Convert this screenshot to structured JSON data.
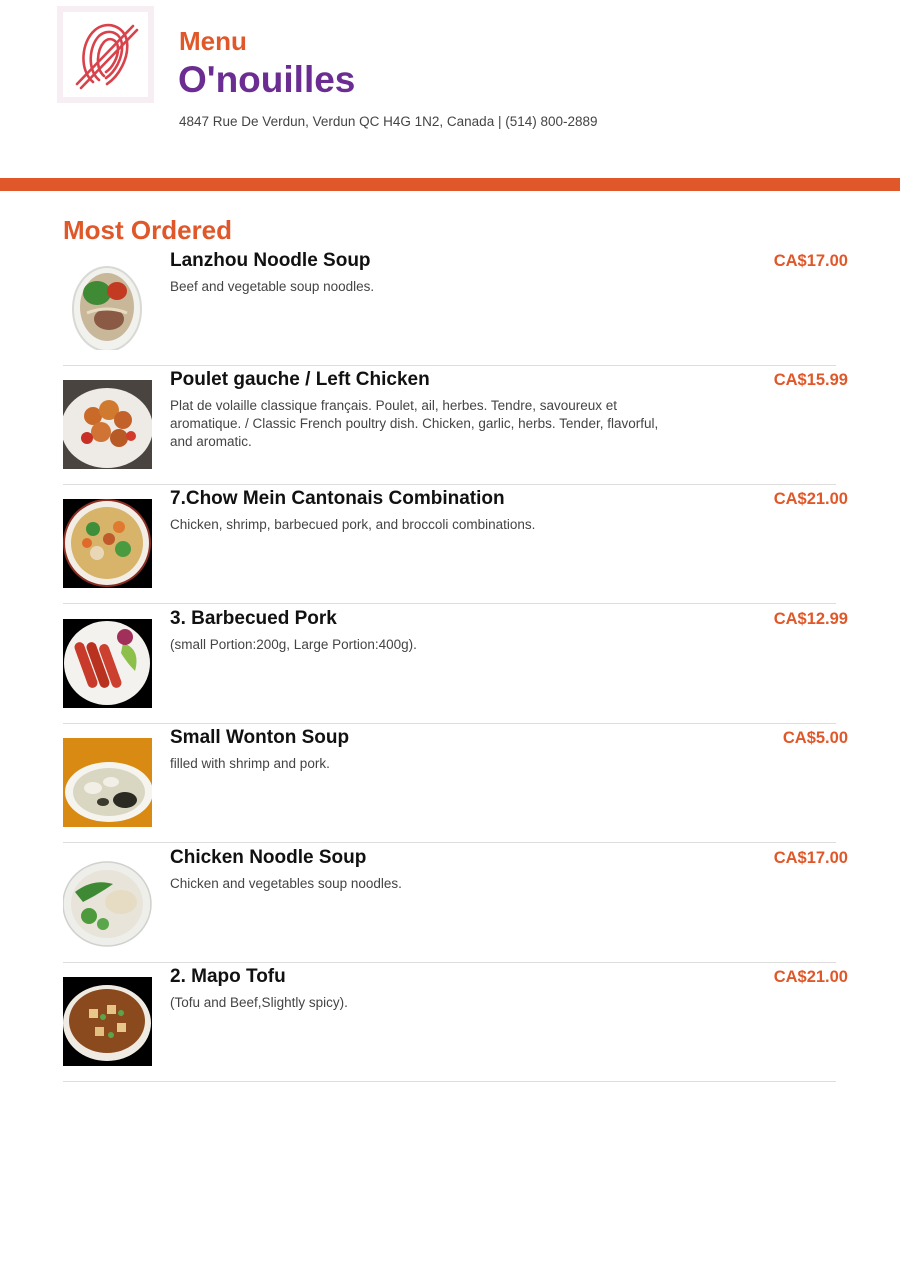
{
  "header": {
    "menu_label": "Menu",
    "restaurant_name": "O'nouilles",
    "address_line": "4847 Rue De Verdun, Verdun QC H4G 1N2, Canada | (514) 800-2889",
    "logo_icon": "noodle-bowl-logo-icon"
  },
  "colors": {
    "accent": "#e0582a",
    "brand": "#6b2d91",
    "text": "#111111",
    "muted": "#444444"
  },
  "section": {
    "title": "Most Ordered"
  },
  "items": [
    {
      "name": "Lanzhou Noodle Soup",
      "description": "Beef and vegetable soup noodles.",
      "price": "CA$17.00",
      "image_icon": "noodle-soup-photo-icon"
    },
    {
      "name": "Poulet gauche / Left Chicken",
      "description": "Plat de volaille classique français. Poulet, ail, herbes. Tendre, savoureux et aromatique. / Classic French poultry dish. Chicken, garlic, herbs. Tender, flavorful, and aromatic.",
      "price": "CA$15.99",
      "image_icon": "chicken-dish-photo-icon"
    },
    {
      "name": "7.Chow Mein Cantonais Combination",
      "description": "Chicken, shrimp, barbecued pork, and broccoli combinations.",
      "price": "CA$21.00",
      "image_icon": "chow-mein-photo-icon"
    },
    {
      "name": "3. Barbecued Pork",
      "description": "(small Portion:200g, Large Portion:400g).",
      "price": "CA$12.99",
      "image_icon": "bbq-pork-photo-icon"
    },
    {
      "name": "Small Wonton Soup",
      "description": "filled with shrimp and pork.",
      "price": "CA$5.00",
      "image_icon": "wonton-soup-photo-icon"
    },
    {
      "name": "Chicken Noodle Soup",
      "description": "Chicken and vegetables soup noodles.",
      "price": "CA$17.00",
      "image_icon": "chicken-noodle-soup-photo-icon"
    },
    {
      "name": "2. Mapo Tofu",
      "description": "(Tofu and Beef,Slightly spicy).",
      "price": "CA$21.00",
      "image_icon": "mapo-tofu-photo-icon"
    }
  ]
}
